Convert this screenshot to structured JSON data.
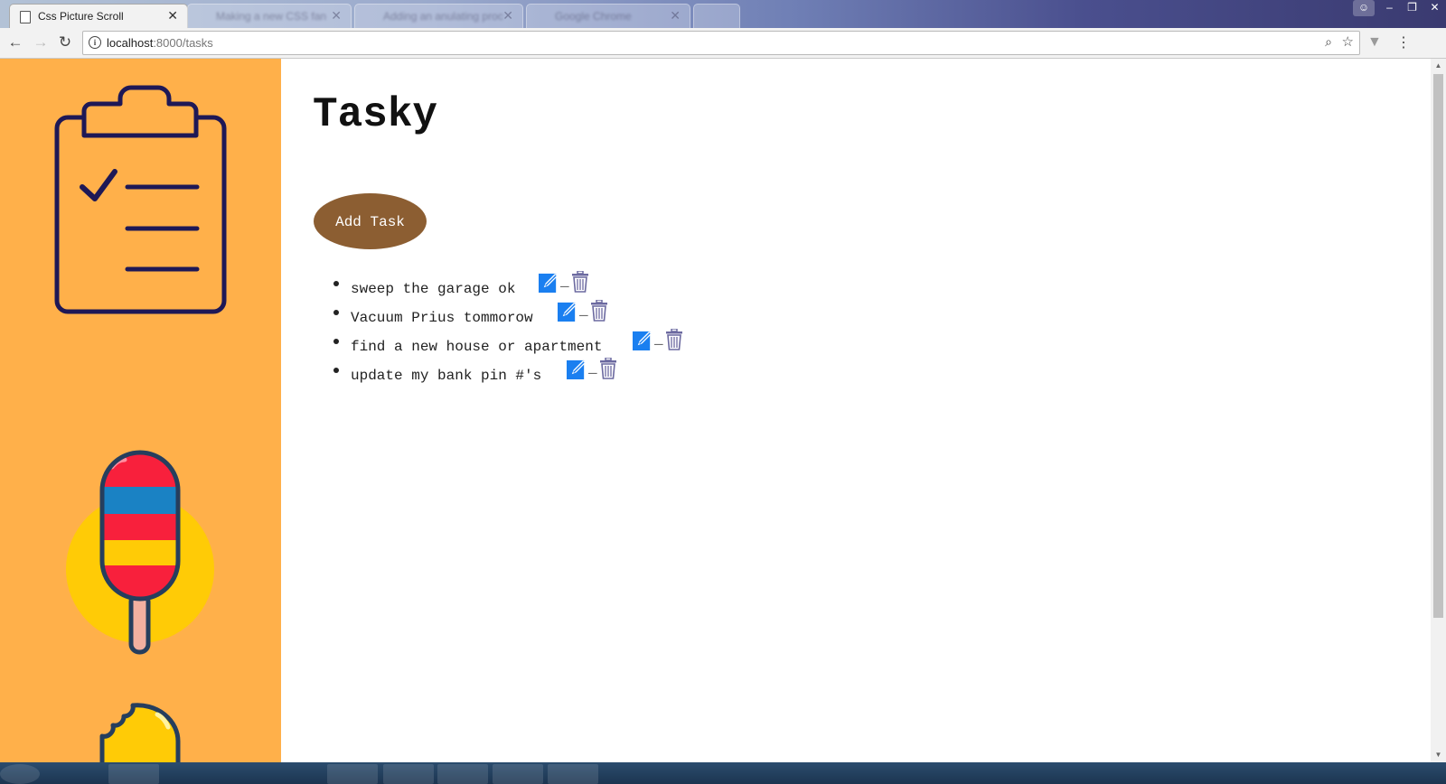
{
  "browser": {
    "active_tab_title": "Css Picture Scroll",
    "background_tabs": [
      "Making a new CSS fan",
      "Adding an anulating proc",
      "Google Chrome"
    ],
    "url_host": "localhost",
    "url_path": ":8000/tasks"
  },
  "page": {
    "title": "Tasky",
    "add_button_label": "Add Task",
    "tasks": [
      {
        "text": "sweep the garage ok"
      },
      {
        "text": "Vacuum Prius tommorow"
      },
      {
        "text": "find a new house or apartment"
      },
      {
        "text": "update my bank pin #'s"
      }
    ],
    "separator": "_"
  },
  "icons": {
    "edit": "edit-icon",
    "delete": "trash-icon",
    "sidebar_1": "clipboard-checklist-icon",
    "sidebar_2": "popsicle-icon",
    "sidebar_3": "bitten-ice-cream-icon"
  },
  "colors": {
    "sidebar_bg": "#ffb04a",
    "add_button": "#8c5e32",
    "edit_icon": "#1a7ff0",
    "icon_outline": "#1e1856"
  }
}
